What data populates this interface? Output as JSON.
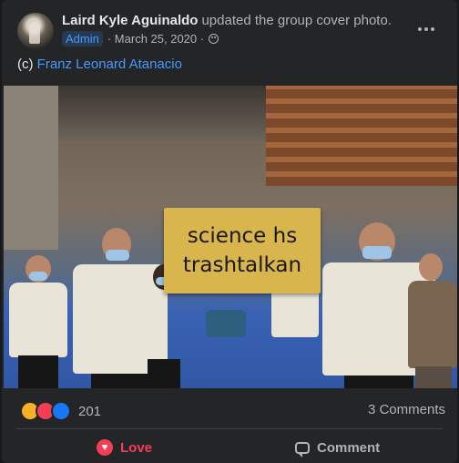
{
  "post": {
    "author": "Laird Kyle Aguinaldo",
    "action_text": "updated the group cover photo.",
    "role_badge": "Admin",
    "date": "· March 25, 2020 ·",
    "caption_prefix": "(c)",
    "caption_link": "Franz Leonard Atanacio"
  },
  "photo": {
    "sign_line1": "science hs",
    "sign_line2": "trashtalkan"
  },
  "stats": {
    "reaction_count": "201",
    "comments": "3 Comments",
    "reactions": [
      "haha",
      "love",
      "like"
    ]
  },
  "actions": {
    "love_label": "Love",
    "comment_label": "Comment"
  },
  "colors": {
    "accent": "#4599ff",
    "love": "#f33e58",
    "card_bg": "#242526"
  }
}
